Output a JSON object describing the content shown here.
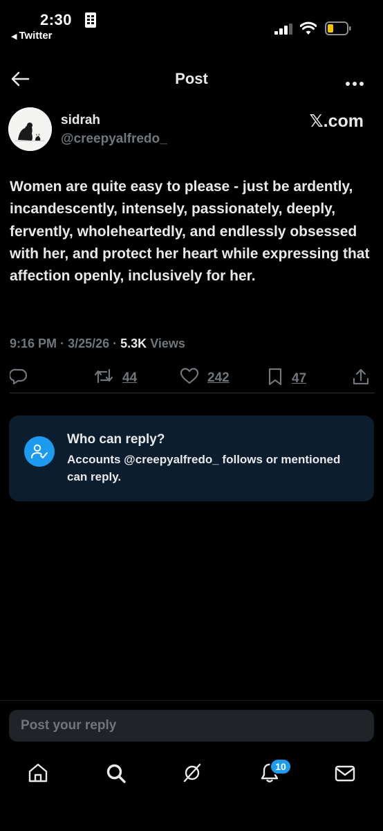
{
  "status_bar": {
    "time": "2:30",
    "back_app": "Twitter",
    "battery_color": "#f5c400"
  },
  "header": {
    "title": "Post",
    "back_icon": "arrow-left-icon",
    "more_icon": "more-horizontal-icon"
  },
  "post": {
    "author": {
      "display_name": "sidrah",
      "handle": "@creepyalfredo_"
    },
    "source_label": "𝕏.com",
    "text": "Women are quite easy to please - just be ardently, incandescently, intensely, passionately, deeply, fervently, wholeheartedly, and endlessly obsessed with her, and protect her heart while expressing that affection openly, inclusively for her.",
    "time": "9:16 PM",
    "date": "3/25/26",
    "views_count": "5.3K",
    "views_label": "Views",
    "separator": "·",
    "actions": {
      "reply_icon": "reply-bubble-icon",
      "reposts": "44",
      "likes": "242",
      "bookmarks": "47",
      "share_icon": "share-icon"
    }
  },
  "reply_restriction": {
    "title": "Who can reply?",
    "description": "Accounts @creepyalfredo_ follows or mentioned can reply.",
    "icon": "user-check-icon"
  },
  "reply_box": {
    "placeholder": "Post your reply"
  },
  "bottom_nav": {
    "items": [
      "home-icon",
      "search-icon",
      "grok-icon",
      "bell-icon",
      "mail-icon"
    ],
    "notification_count": "10"
  },
  "colors": {
    "background": "#000000",
    "accent": "#1d9bf0",
    "secondary_text": "#71767b",
    "card_background": "#0c1e2e"
  }
}
